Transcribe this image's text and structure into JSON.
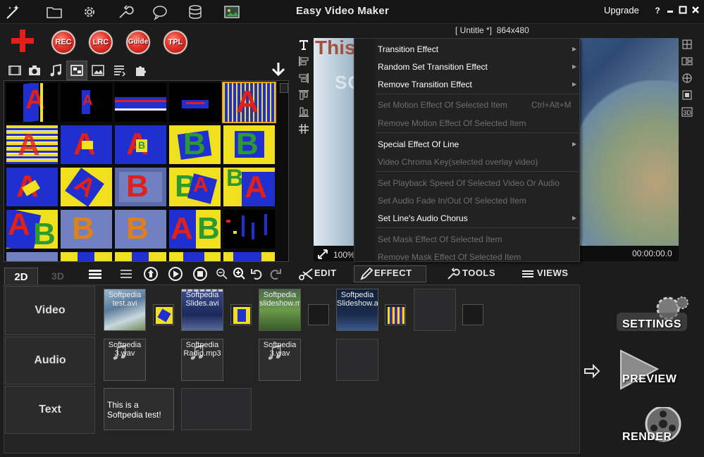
{
  "app": {
    "title": "Easy Video Maker",
    "upgrade": "Upgrade",
    "help": "?",
    "minimize": "▪",
    "maximize": "▫",
    "close": "✕"
  },
  "record": {
    "rec": "REC",
    "lrc": "LRC",
    "guide": "Guide",
    "tpl": "TPL"
  },
  "project": {
    "name": "[ Untitle *]",
    "resolution": "864x480"
  },
  "preview": {
    "overlay_text": "This",
    "watermark": "SOFTPEDIA",
    "zoom": "100%",
    "timecode": "00:00:00.0"
  },
  "context_menu": {
    "items": [
      {
        "label": "Transition Effect",
        "enabled": true,
        "submenu": true
      },
      {
        "label": "Random Set Transition Effect",
        "enabled": true,
        "submenu": true
      },
      {
        "label": "Remove Transition Effect",
        "enabled": true,
        "submenu": true
      },
      {
        "label": "Set Motion Effect Of Selected Item",
        "enabled": false,
        "shortcut": "Ctrl+Alt+M"
      },
      {
        "label": "Remove Motion Effect Of Selected Item",
        "enabled": false
      },
      {
        "label": "Special Effect Of Line",
        "enabled": true,
        "submenu": true
      },
      {
        "label": "Video Chroma Key(selected overlay video)",
        "enabled": false
      },
      {
        "label": "Set Playback Speed Of Selected Video Or Audio",
        "enabled": false
      },
      {
        "label": "Set Audio Fade In/Out Of Selected Item",
        "enabled": false
      },
      {
        "label": "Set Line's Audio Chorus",
        "enabled": true,
        "submenu": true
      },
      {
        "label": "Set Mask Effect Of Selected Item",
        "enabled": false
      },
      {
        "label": "Remove Mask Effect Of Selected Item",
        "enabled": false
      }
    ]
  },
  "timeline_toolbar": {
    "tab_2d": "2D",
    "tab_3d": "3D",
    "edit": "EDIT",
    "effect": "EFFECT",
    "tools": "TOOLS",
    "views": "VIEWS"
  },
  "tracks": {
    "video": "Video",
    "audio": "Audio",
    "text": "Text"
  },
  "clips": {
    "video": [
      "Softpedia test.avi",
      "Softpedia Slides.avi",
      "Softpedia slideshow.mov",
      "Softpedia Slideshow.avi"
    ],
    "audio": [
      "Softpedia 3.wav",
      "Softpedia Radio.mp3",
      "Softpedia 3.wav"
    ],
    "text": [
      "This is a Softpedia test!"
    ]
  },
  "actions": {
    "settings": "SETTINGS",
    "preview": "PREVIEW",
    "render": "RENDER"
  },
  "colors": {
    "accent_red": "#e2342a",
    "selection": "#e8a020",
    "menu_bg": "#222222"
  },
  "icons": [
    "wand-icon",
    "folder-icon",
    "gear-icon",
    "wrench-icon",
    "speech-bubble-icon",
    "database-icon",
    "image-icon"
  ]
}
